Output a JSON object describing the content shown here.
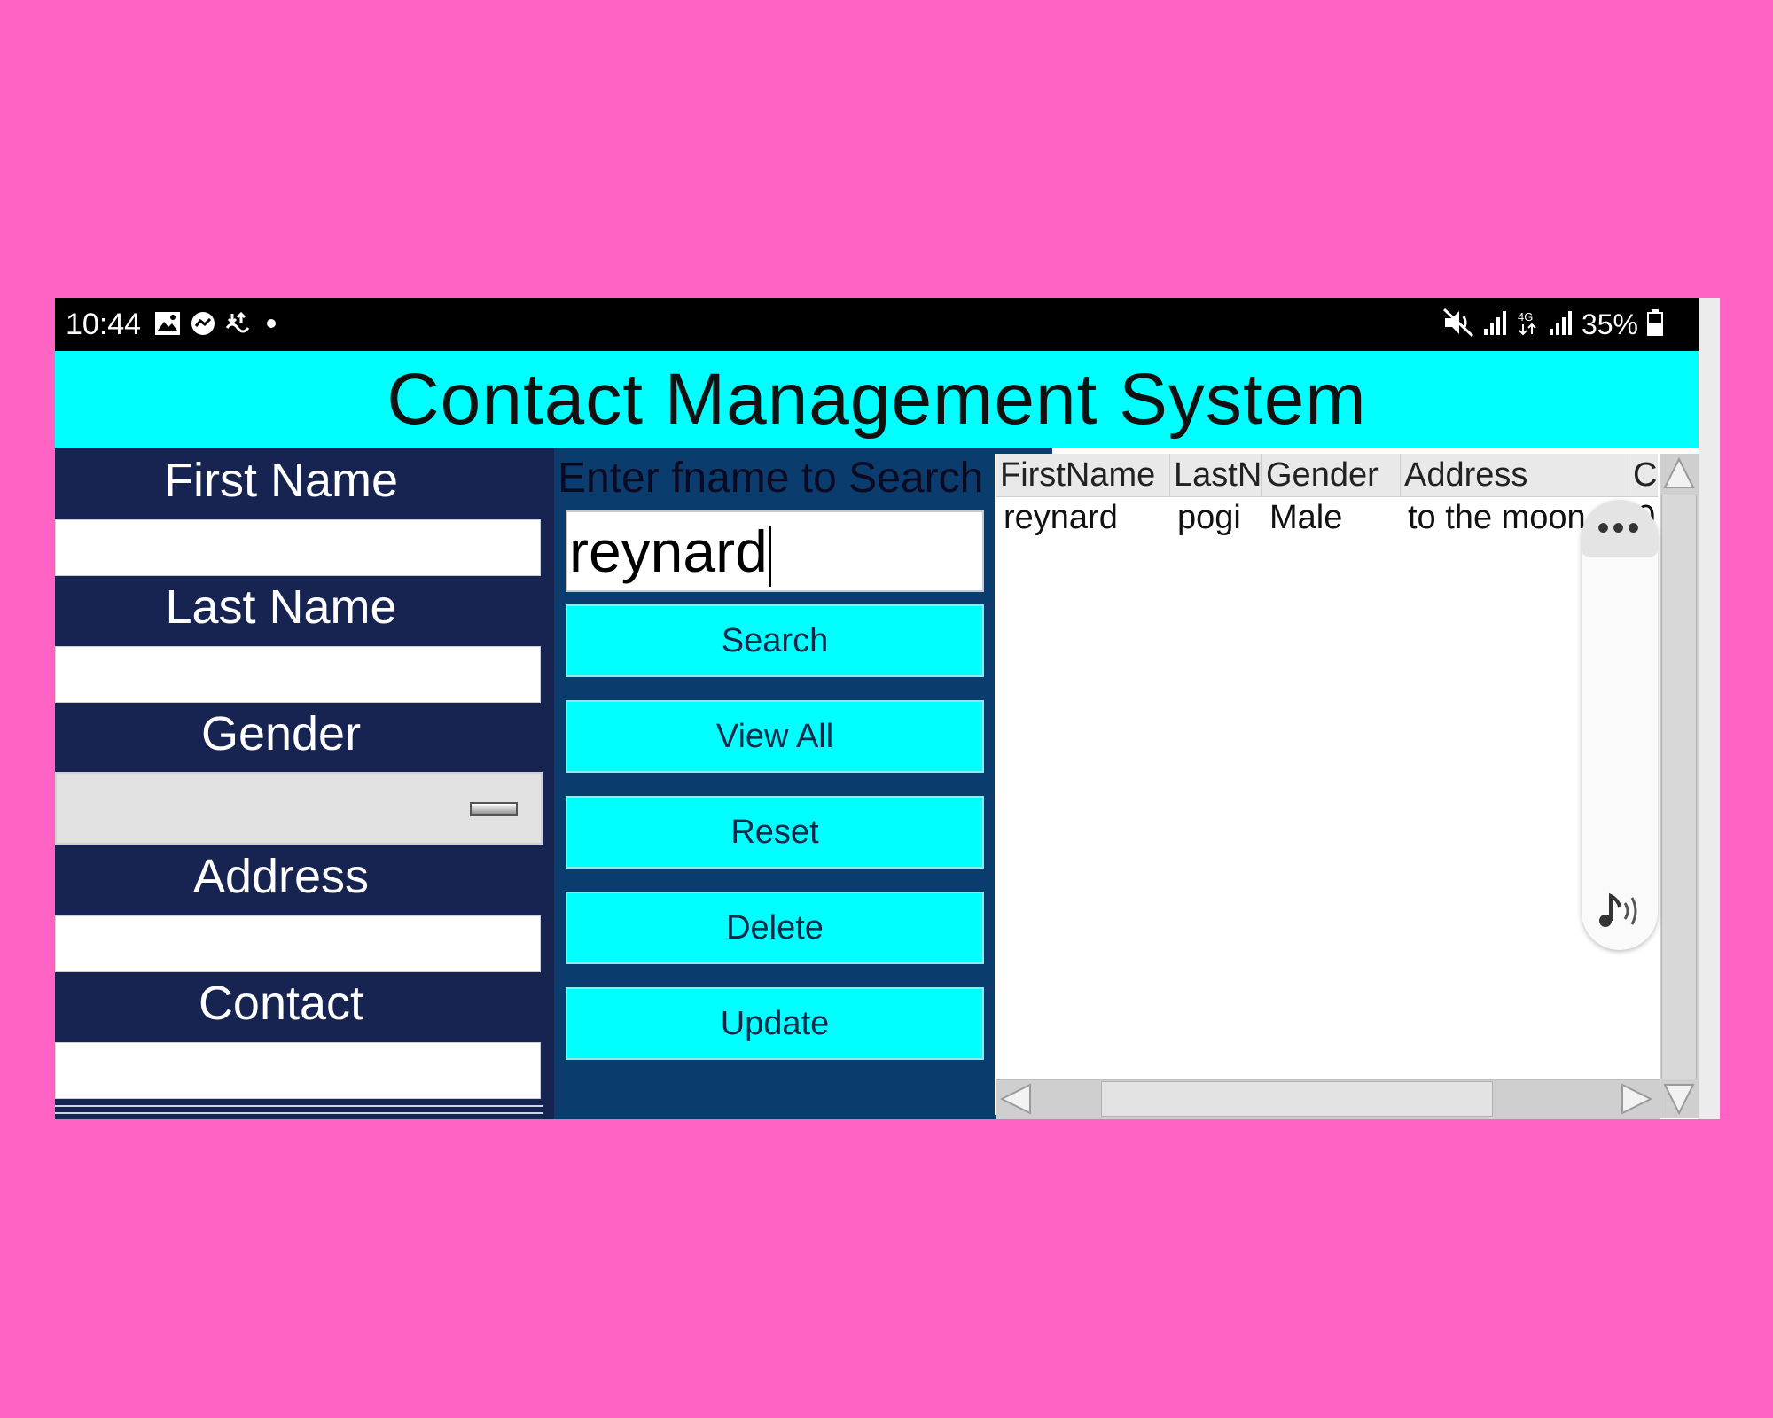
{
  "status_bar": {
    "time": "10:44",
    "icons": [
      "gallery-icon",
      "messenger-icon",
      "data-transfer-icon",
      "dot-icon"
    ],
    "right_icons": [
      "mute-icon",
      "signal-icon",
      "4g-icon",
      "signal-icon"
    ],
    "battery": "35%"
  },
  "header": {
    "title": "Contact Management System"
  },
  "form": {
    "first_name_label": "First Name",
    "last_name_label": "Last Name",
    "gender_label": "Gender",
    "address_label": "Address",
    "contact_label": "Contact",
    "first_name_value": "",
    "last_name_value": "",
    "gender_value": "",
    "address_value": "",
    "contact_value": ""
  },
  "search": {
    "label": "Enter fname to Search",
    "value": "reynard"
  },
  "buttons": {
    "search": "Search",
    "view_all": "View All",
    "reset": "Reset",
    "delete": "Delete",
    "update": "Update"
  },
  "table": {
    "columns": [
      "FirstName",
      "LastN",
      "Gender",
      "Address",
      "C"
    ],
    "rows": [
      [
        "reynard",
        "pogi",
        "Male",
        "to the moon",
        "0"
      ]
    ]
  },
  "floating_toolbar": {
    "more_label": "•••",
    "sound_icon": "music-sound-icon"
  },
  "colors": {
    "background": "#ff63c4",
    "header": "#00ffff",
    "left_panel": "#172350",
    "mid_panel": "#0a3d6e",
    "button": "#00ffff"
  }
}
